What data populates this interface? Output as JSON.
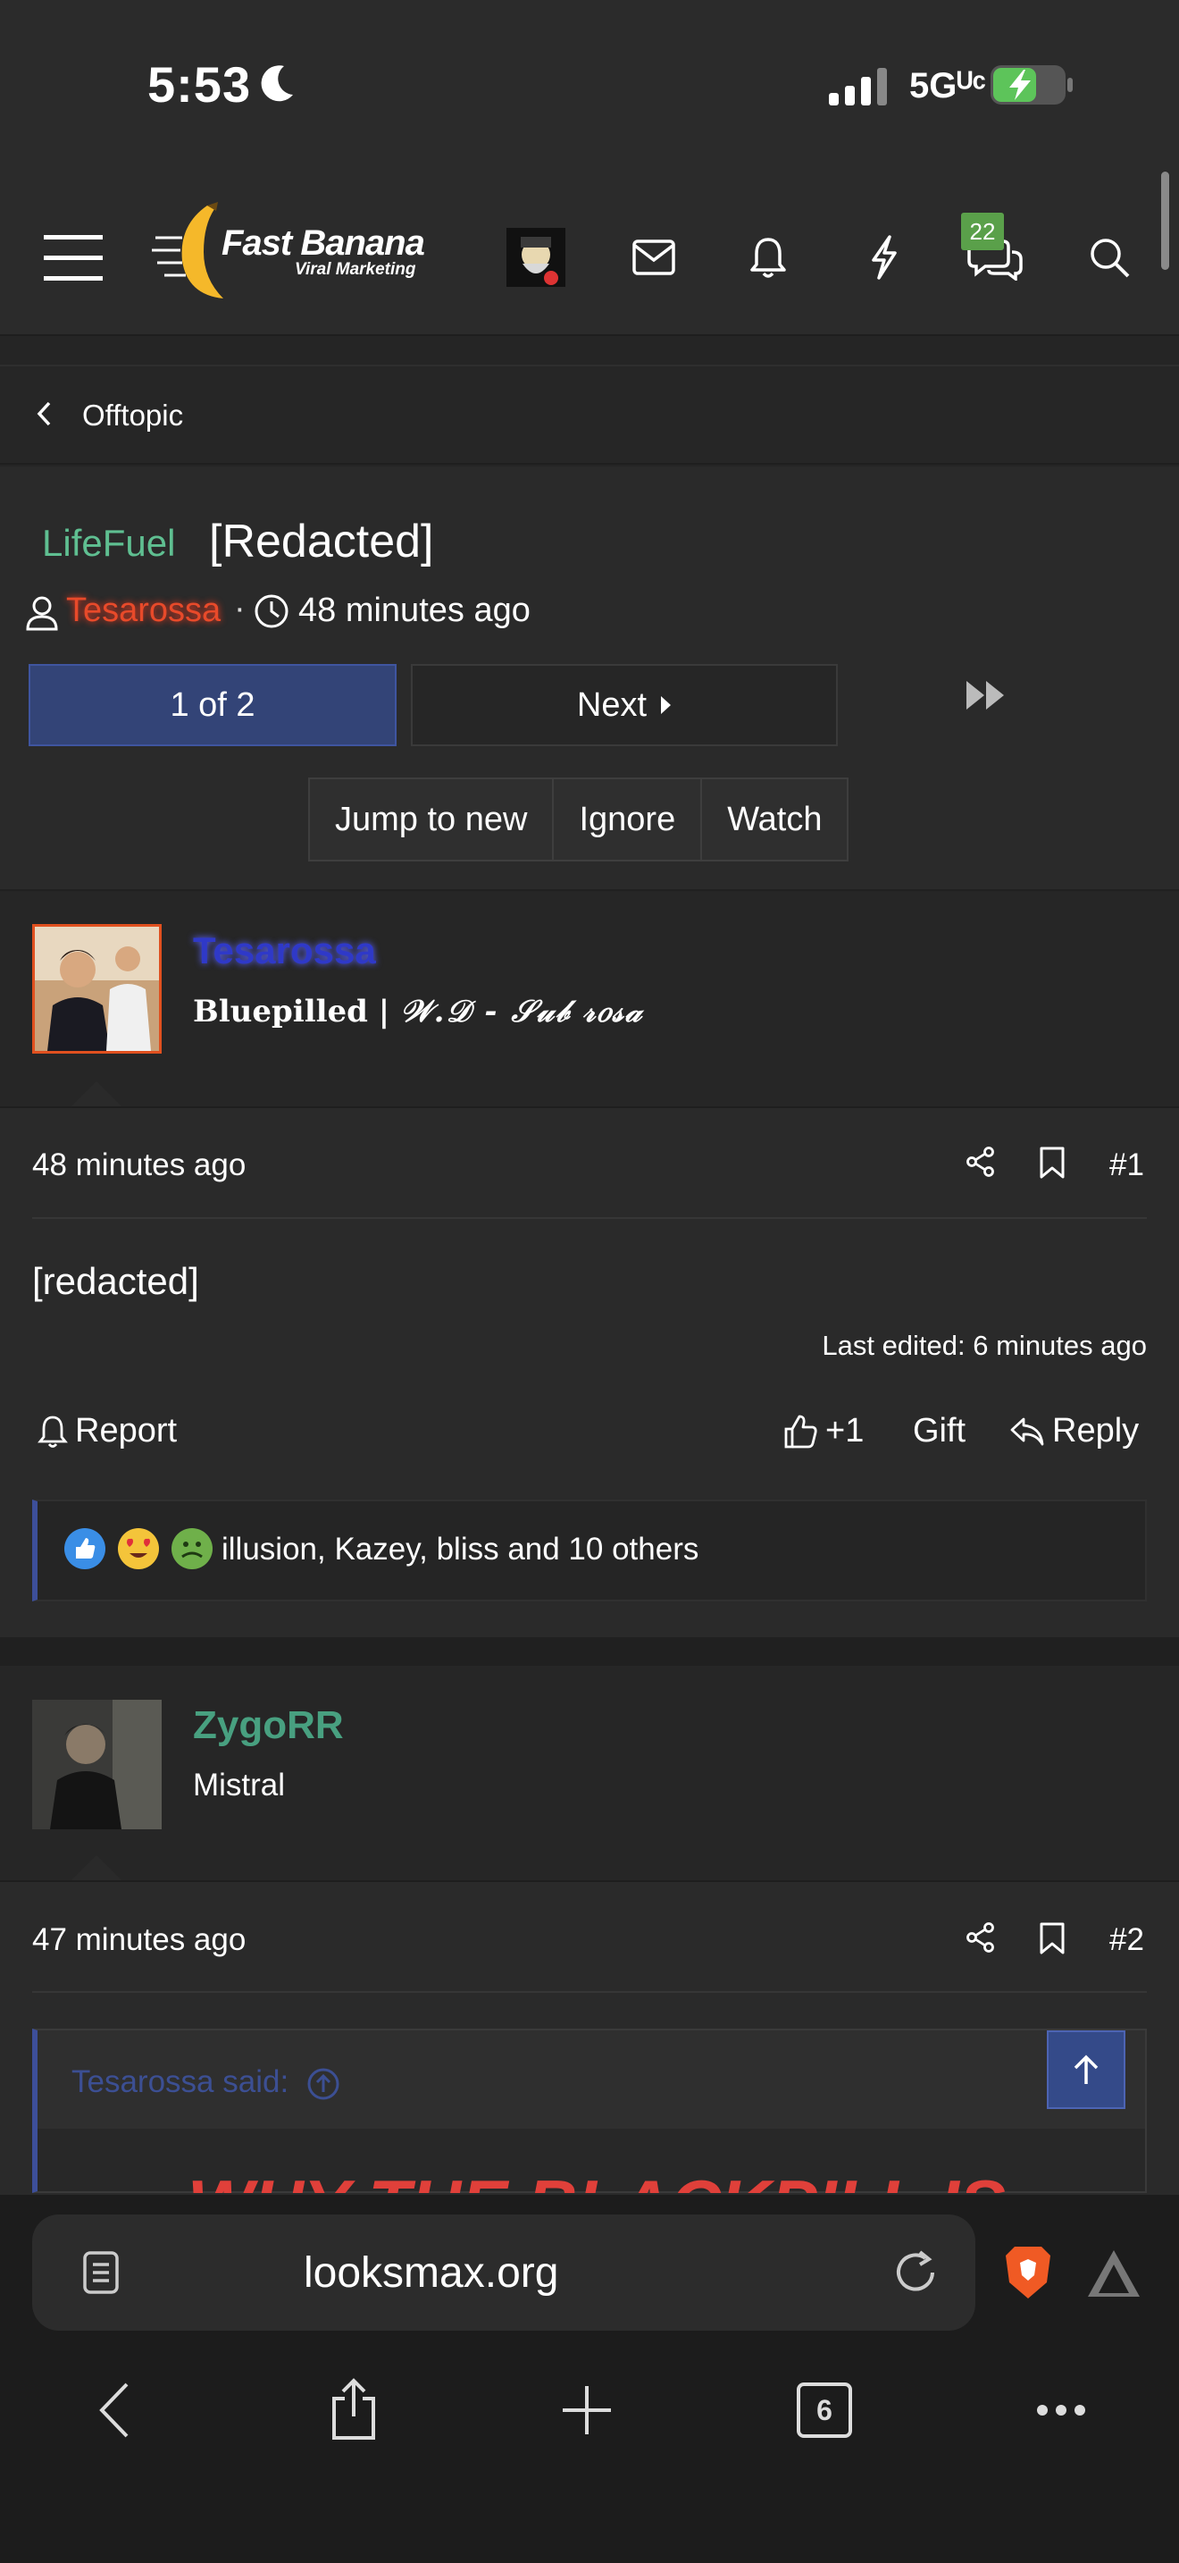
{
  "status_bar": {
    "time": "5:53",
    "network": "5Gᵁᶜ"
  },
  "header": {
    "brand_name": "Fast Banana",
    "brand_tagline": "Viral Marketing",
    "conversations_badge": "22"
  },
  "breadcrumb": {
    "label": "Offtopic"
  },
  "thread": {
    "prefix": "LifeFuel",
    "title": "[Redacted]",
    "author": "Tesarossa",
    "meta_separator": "·",
    "time": "48 minutes ago",
    "pagination": {
      "current": "1 of 2",
      "next": "Next"
    },
    "actions": [
      "Jump to new",
      "Ignore",
      "Watch"
    ]
  },
  "posts": [
    {
      "username": "Tesarossa",
      "user_title": "Bluepilled | ",
      "user_signature": "𝒲.𝒟 - 𝒮𝓊𝒷 𝓇𝑜𝓈𝒶",
      "time": "48 minutes ago",
      "number": "#1",
      "content": "[redacted]",
      "edited": "Last edited: 6 minutes ago",
      "footer": {
        "report": "Report",
        "like": "+1",
        "gift": "Gift",
        "reply": "Reply"
      },
      "reactions_text": "illusion, Kazey, bliss and 10 others"
    },
    {
      "username": "ZygoRR",
      "user_title": "Mistral",
      "time": "47 minutes ago",
      "number": "#2",
      "quote_author": "Tesarossa said:",
      "quote_heading": "WHY THE BLACKPILL IS"
    }
  ],
  "browser": {
    "url": "looksmax.org",
    "tab_count": "6"
  },
  "colors": {
    "accent_blue": "#334477",
    "prefix_green": "#5fbf91",
    "author_red": "#e84a2a",
    "username_blue": "#2f39c8",
    "username_green": "#48a080",
    "badge_green": "#5aa04a"
  }
}
